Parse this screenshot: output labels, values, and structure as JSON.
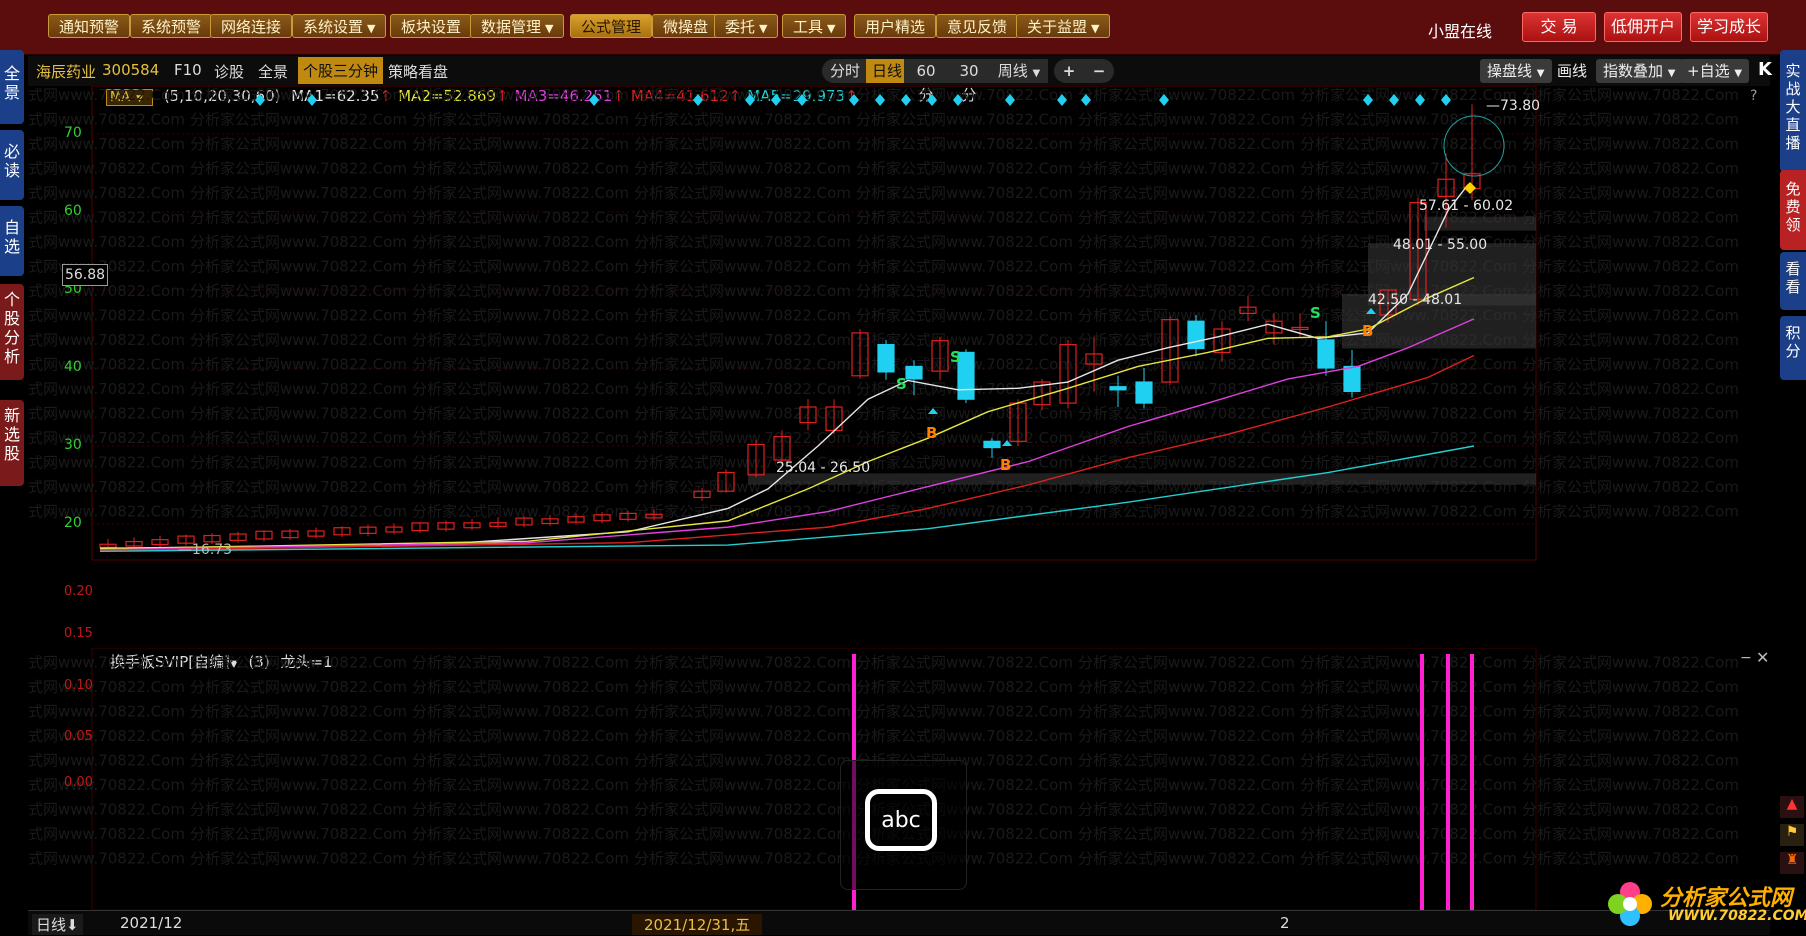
{
  "toolbar": {
    "items": [
      {
        "label": "通知预警",
        "dd": false
      },
      {
        "label": "系统预警",
        "dd": false
      },
      {
        "label": "网络连接",
        "dd": false
      },
      {
        "label": "系统设置",
        "dd": true
      },
      {
        "label": "板块设置",
        "dd": false
      },
      {
        "label": "数据管理",
        "dd": true
      },
      {
        "label": "公式管理",
        "dd": false,
        "active": true
      },
      {
        "label": "微操盘",
        "dd": false
      },
      {
        "label": "委托",
        "dd": true
      },
      {
        "label": "工具",
        "dd": true
      },
      {
        "label": "用户精选",
        "dd": false
      },
      {
        "label": "意见反馈",
        "dd": false
      },
      {
        "label": "关于益盟",
        "dd": true
      }
    ],
    "online": "小盟在线",
    "right_buttons": [
      "交 易",
      "低佣开户",
      "学习成长"
    ]
  },
  "left_tabs": [
    "全景",
    "必读",
    "自选",
    "个股分析",
    "新选股"
  ],
  "right_tabs": [
    "实战大直播",
    "免费领",
    "看看",
    "积分"
  ],
  "stock": {
    "name": "海辰药业",
    "code": "300584",
    "links": [
      "F10",
      "诊股",
      "全景",
      "个股三分钟",
      "策略看盘"
    ],
    "periods": [
      "分时",
      "日线",
      "60分",
      "30分",
      "周线"
    ],
    "active_period": "日线",
    "right_buttons": [
      "操盘线",
      "画线",
      "指数叠加",
      "+自选"
    ],
    "k_label": "K"
  },
  "ma": {
    "selector": "MA",
    "params": "(5,10,20,30,60)",
    "values": [
      {
        "text": "MA1=62.35",
        "arrow": "↑",
        "color": "#e6e6e6"
      },
      {
        "text": "MA2=52.869",
        "arrow": "↑",
        "color": "#e6e640"
      },
      {
        "text": "MA3=46.251",
        "arrow": "↑",
        "color": "#e040e0"
      },
      {
        "text": "MA4=41.612",
        "arrow": "↑",
        "color": "#e02020"
      },
      {
        "text": "MA5=29.973",
        "arrow": "↑",
        "color": "#20d0d0"
      }
    ]
  },
  "axis": {
    "main_ticks": [
      "70",
      "60",
      "50",
      "40",
      "30",
      "20"
    ],
    "current_price": "56.88",
    "sub_ticks": [
      "0.20",
      "0.15",
      "0.10",
      "0.05",
      "0.00"
    ]
  },
  "annotations": {
    "high": "73.80",
    "low": "16.73",
    "zones": [
      "57.61 - 60.02",
      "48.01 - 55.00",
      "42.50 - 48.01",
      "25.04 - 26.50"
    ],
    "signal_buy": "B",
    "signal_sell": "S"
  },
  "sub_indicator": {
    "name": "换手板SVIP[自编]",
    "param": "(3)",
    "value": "龙头=1"
  },
  "bottom": {
    "period_label": "日线",
    "date_left": "2021/12",
    "date_cursor": "2021/12/31,五",
    "month_2": "2"
  },
  "overlay": {
    "abc": "abc"
  },
  "watermark": "分析家公式网www.70822.Com",
  "logo": {
    "name": "分析家公式网",
    "url": "WWW.70822.COM"
  },
  "colors": {
    "up": "#e02020",
    "down": "#20d0f0",
    "accent": "#c08a10",
    "ma1": "#e6e6e6",
    "ma2": "#e6e640",
    "ma3": "#e040e0",
    "ma4": "#e02020",
    "ma5": "#20d0d0"
  }
}
